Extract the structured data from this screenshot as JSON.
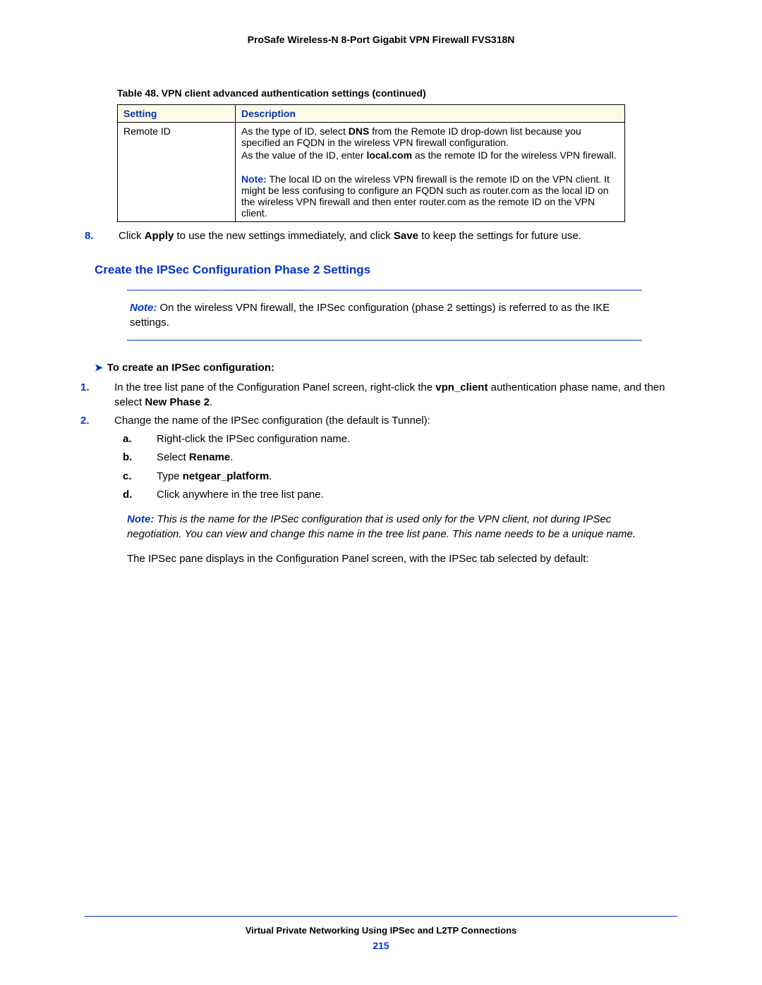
{
  "header": {
    "title": "ProSafe Wireless-N 8-Port Gigabit VPN Firewall FVS318N"
  },
  "table": {
    "caption": "Table 48.  VPN client advanced authentication settings (continued)",
    "headers": {
      "setting": "Setting",
      "description": "Description"
    },
    "row": {
      "setting": "Remote ID",
      "p1a": "As the type of ID, select ",
      "p1b": "DNS",
      "p1c": " from the Remote ID drop-down list because you specified an FQDN in the wireless VPN firewall configuration.",
      "p2a": "As the value of the ID, enter ",
      "p2b": "local.com",
      "p2c": " as the remote ID for the wireless VPN firewall.",
      "note_label": "Note:",
      "note_text": "  The local ID on the wireless VPN firewall is the remote ID on the VPN client. It might be less confusing to configure an FQDN such as router.com as the local ID on the wireless VPN firewall and then enter router.com as the remote ID on the VPN client."
    }
  },
  "step8": {
    "num": "8.",
    "a": "Click ",
    "b1": "Apply",
    "c": " to use the new settings immediately, and click ",
    "b2": "Save",
    "d": " to keep the settings for future use."
  },
  "section_heading": "Create the IPSec Configuration Phase 2 Settings",
  "note_block": {
    "label": "Note:",
    "text": "  On the wireless VPN firewall, the IPSec configuration (phase 2 settings) is referred to as the IKE settings."
  },
  "proc_head": "To create an IPSec configuration:",
  "s1": {
    "num": "1.",
    "a": "In the tree list pane of the Configuration Panel screen, right-click the ",
    "b1": "vpn_client",
    "c": " authentication phase name, and then select ",
    "b2": "New Phase 2",
    "d": "."
  },
  "s2": {
    "num": "2.",
    "text": "Change the name of the IPSec configuration (the default is Tunnel):"
  },
  "sa": {
    "l": "a.",
    "text": "Right-click the IPSec configuration name."
  },
  "sb": {
    "l": "b.",
    "a": "Select ",
    "b": "Rename",
    "c": "."
  },
  "sc": {
    "l": "c.",
    "a": "Type ",
    "b": "netgear_platform",
    "c": "."
  },
  "sd": {
    "l": "d.",
    "text": "Click anywhere in the tree list pane."
  },
  "inline_note": {
    "label": "Note:",
    "text": "  This is the name for the IPSec configuration that is used only for the VPN client, not during IPSec negotiation. You can view and change this name in the tree list pane. This name needs to be a unique name."
  },
  "closing_para": "The IPSec pane displays in the Configuration Panel screen, with the IPSec tab selected by default:",
  "footer": {
    "title": "Virtual Private Networking Using IPSec and L2TP Connections",
    "page": "215"
  }
}
